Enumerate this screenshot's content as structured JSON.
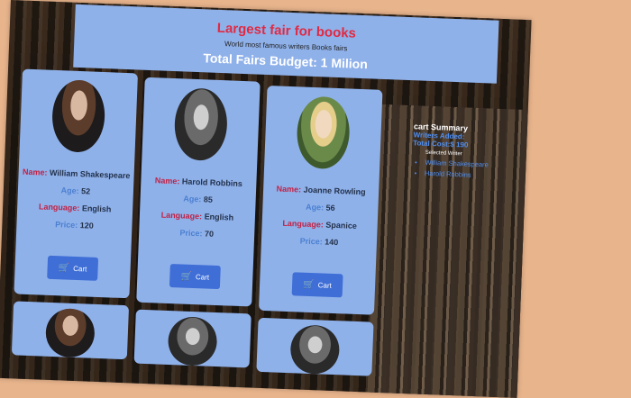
{
  "header": {
    "title": "Largest fair for books",
    "subtitle": "World most famous writers Books fairs",
    "budget": "Total Fairs Budget: 1 Milion"
  },
  "labels": {
    "name": "Name:",
    "age": "Age:",
    "language": "Language:",
    "price": "Price:",
    "cart": "Cart"
  },
  "writers": [
    {
      "name": "William Shakespeare",
      "age": "52",
      "language": "English",
      "price": "120"
    },
    {
      "name": "Harold Robbins",
      "age": "85",
      "language": "English",
      "price": "70"
    },
    {
      "name": "Joanne Rowling",
      "age": "56",
      "language": "Spanice",
      "price": "140"
    }
  ],
  "summary": {
    "title": "cart Summary",
    "writers_added": "Writers Added: ",
    "total_cost": "Total Cost:$ 190",
    "selected_label": "Selected Writer",
    "selected": [
      "William Shakespeare",
      "Harold Robbins"
    ]
  },
  "colors": {
    "header_bg": "#8fb1ea",
    "title": "#e02a43",
    "button": "#3f6ed6"
  }
}
